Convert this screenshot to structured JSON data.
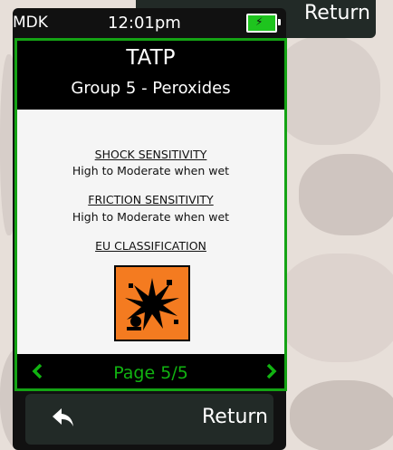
{
  "status": {
    "carrier": "MDK",
    "time": "12:01pm",
    "battery_icon": "battery-charging-icon"
  },
  "top_button": {
    "label": "Return"
  },
  "panel": {
    "title": "TATP",
    "subtitle": "Group 5 - Peroxides",
    "sections": [
      {
        "heading": "SHOCK SENSITIVITY",
        "value": "High to Moderate when wet"
      },
      {
        "heading": "FRICTION SENSITIVITY",
        "value": "High to Moderate when wet"
      },
      {
        "heading": "EU CLASSIFICATION"
      }
    ],
    "hazard_icon": "explosive-hazard-icon",
    "hazard_color": "#f47b20"
  },
  "pager": {
    "label": "Page 5/5",
    "prev_icon": "chevron-left-icon",
    "next_icon": "chevron-right-icon",
    "color": "#11b311"
  },
  "bottom_button": {
    "label": "Return",
    "icon": "back-arrow-icon"
  }
}
